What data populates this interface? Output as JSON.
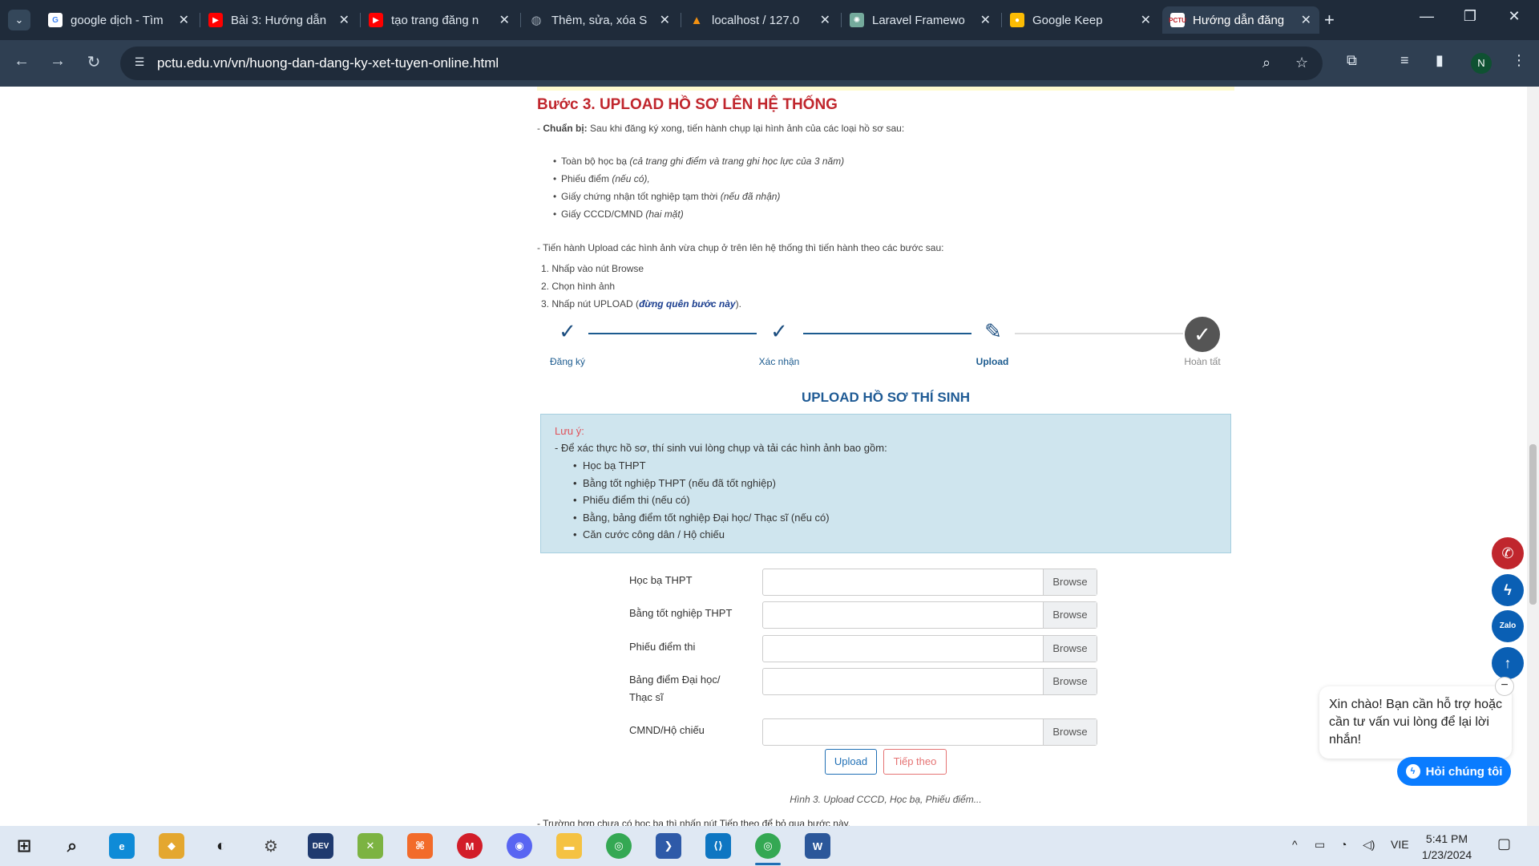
{
  "browser": {
    "tabs": [
      {
        "title": "google dịch - Tìm",
        "favicon": "google-icon",
        "favicon_color": "#ffffff"
      },
      {
        "title": "Bài 3: Hướng dẫn",
        "favicon": "youtube-icon",
        "favicon_color": "#ff0000"
      },
      {
        "title": "tạo trang đăng n",
        "favicon": "youtube-icon",
        "favicon_color": "#ff0000"
      },
      {
        "title": "Thêm, sửa, xóa S",
        "favicon": "globe-icon",
        "favicon_color": "#9aa5b1"
      },
      {
        "title": "localhost / 127.0",
        "favicon": "phpmyadmin-icon",
        "favicon_color": "#f29111"
      },
      {
        "title": "Laravel Framewo",
        "favicon": "openai-icon",
        "favicon_color": "#74aa9c"
      },
      {
        "title": "Google Keep",
        "favicon": "keep-icon",
        "favicon_color": "#fbbc04"
      },
      {
        "title": "Hướng dẫn đăng",
        "favicon": "pctu-icon",
        "favicon_color": "#c0262d",
        "active": true
      }
    ],
    "url": "pctu.edu.vn/vn/huong-dan-dang-ky-xet-tuyen-online.html",
    "profile_initial": "N"
  },
  "article": {
    "step_heading": "Bước 3. UPLOAD HỒ SƠ LÊN HỆ THỐNG",
    "prep_label": "Chuẩn bị:",
    "prep_text": "Sau khi đăng ký xong, tiến hành chụp lại hình ảnh của các loại hồ sơ sau:",
    "prep_items": [
      {
        "text": "Toàn bộ học bạ",
        "note": "(cả trang ghi điểm và trang ghi học lực của 3 năm)"
      },
      {
        "text": "Phiếu điểm",
        "note": "(nếu có),"
      },
      {
        "text": "Giấy chứng nhận tốt nghiệp tạm thời",
        "note": "(nếu đã nhận)"
      },
      {
        "text": "Giấy CCCD/CMND",
        "note": "(hai mặt)"
      }
    ],
    "upload_intro": "- Tiến hành Upload các hình ảnh vừa chụp ở trên lên hệ thống thì tiến hành theo các bước sau:",
    "upload_steps": [
      "1. Nhấp vào nút Browse",
      "2. Chọn hình ảnh",
      "3. Nhấp nút UPLOAD ("
    ],
    "upload_step3_emphasis": "đừng quên bước này",
    "upload_step3_end": ")."
  },
  "stepper": {
    "steps": [
      {
        "label": "Đăng ký",
        "state": "done"
      },
      {
        "label": "Xác nhận",
        "state": "done"
      },
      {
        "label": "Upload",
        "state": "current"
      },
      {
        "label": "Hoàn tất",
        "state": "pending"
      }
    ]
  },
  "form": {
    "title": "UPLOAD HỒ SƠ THÍ SINH",
    "notice_title": "Lưu ý:",
    "notice_intro": "- Để xác thực hồ sơ, thí sinh vui lòng chụp và tải các hình ảnh bao gồm:",
    "notice_items": [
      "Học bạ THPT",
      "Bằng tốt nghiệp THPT (nếu đã tốt nghiệp)",
      "Phiếu điểm thi (nếu có)",
      "Bằng, bảng điểm tốt nghiệp Đại học/ Thạc sĩ (nếu có)",
      "Căn cước công dân / Hộ chiếu"
    ],
    "fields": [
      {
        "label": "Học bạ THPT",
        "value": ""
      },
      {
        "label": "Bằng tốt nghiệp THPT",
        "value": ""
      },
      {
        "label": "Phiếu điểm thi",
        "value": ""
      },
      {
        "label": "Bảng điểm Đại học/ Thạc sĩ",
        "value": ""
      },
      {
        "label": "CMND/Hộ chiếu",
        "value": ""
      }
    ],
    "browse_label": "Browse",
    "upload_button": "Upload",
    "next_button": "Tiếp theo",
    "caption": "Hình 3. Upload CCCD, Học bạ, Phiếu điểm...",
    "cutoff_text": "- Trường hợp chưa có học bạ thì nhấn nút Tiếp theo để bỏ qua bước này."
  },
  "chat": {
    "greeting": "Xin chào! Bạn cần hỗ trợ hoặc cần tư vấn vui lòng để lại lời nhắn!",
    "button": "Hỏi chúng tôi",
    "fab_colors": {
      "phone": "#c0262d",
      "messenger": "#0a5fb4",
      "zalo": "#0a5fb4",
      "top": "#0a5fb4"
    }
  },
  "taskbar": {
    "language": "VIE",
    "time": "5:41 PM",
    "date": "1/23/2024"
  }
}
